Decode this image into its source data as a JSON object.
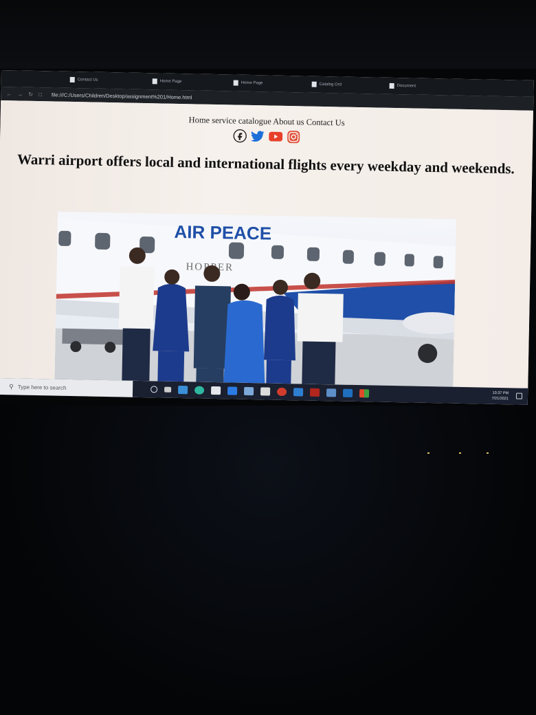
{
  "browser": {
    "tabs": [
      "Contact Us",
      "Home Page",
      "Home Page",
      "Catalog Ord",
      "Document"
    ],
    "url": "file:///C:/Users/Children/Desktop/assignment%201/Home.html"
  },
  "page": {
    "nav": {
      "home": "Home",
      "service_catalogue": "service catalogue",
      "about": "About us",
      "contact": "Contact Us"
    },
    "social_icons": [
      "facebook-icon",
      "twitter-icon",
      "youtube-icon",
      "instagram-icon"
    ],
    "headline": "Warri airport offers local and international flights every weekday and weekends.",
    "photo": {
      "airline_text": "AIR PEACE",
      "aircraft_text": "HOPPER"
    }
  },
  "taskbar": {
    "search_placeholder": "Type here to search",
    "time": "10:37 PM",
    "date": "7/21/2021"
  },
  "colors": {
    "page_bg": "#f3ece7",
    "taskbar": "#1a2030",
    "facebook": "#222222",
    "twitter": "#1d6fd8",
    "youtube": "#e8402a",
    "instagram": "#e0553c"
  }
}
